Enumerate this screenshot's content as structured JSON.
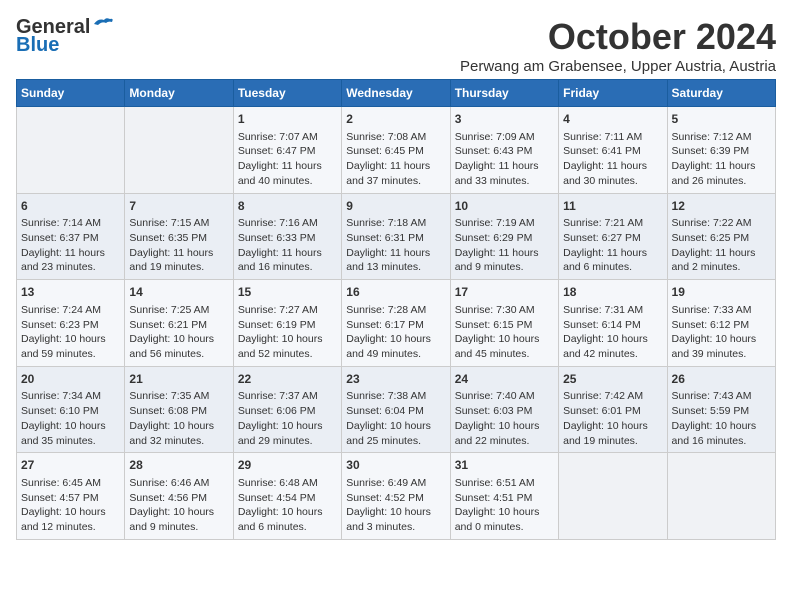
{
  "logo": {
    "general": "General",
    "blue": "Blue"
  },
  "title": "October 2024",
  "location": "Perwang am Grabensee, Upper Austria, Austria",
  "headers": [
    "Sunday",
    "Monday",
    "Tuesday",
    "Wednesday",
    "Thursday",
    "Friday",
    "Saturday"
  ],
  "weeks": [
    [
      {
        "day": "",
        "sunrise": "",
        "sunset": "",
        "daylight": ""
      },
      {
        "day": "",
        "sunrise": "",
        "sunset": "",
        "daylight": ""
      },
      {
        "day": "1",
        "sunrise": "Sunrise: 7:07 AM",
        "sunset": "Sunset: 6:47 PM",
        "daylight": "Daylight: 11 hours and 40 minutes."
      },
      {
        "day": "2",
        "sunrise": "Sunrise: 7:08 AM",
        "sunset": "Sunset: 6:45 PM",
        "daylight": "Daylight: 11 hours and 37 minutes."
      },
      {
        "day": "3",
        "sunrise": "Sunrise: 7:09 AM",
        "sunset": "Sunset: 6:43 PM",
        "daylight": "Daylight: 11 hours and 33 minutes."
      },
      {
        "day": "4",
        "sunrise": "Sunrise: 7:11 AM",
        "sunset": "Sunset: 6:41 PM",
        "daylight": "Daylight: 11 hours and 30 minutes."
      },
      {
        "day": "5",
        "sunrise": "Sunrise: 7:12 AM",
        "sunset": "Sunset: 6:39 PM",
        "daylight": "Daylight: 11 hours and 26 minutes."
      }
    ],
    [
      {
        "day": "6",
        "sunrise": "Sunrise: 7:14 AM",
        "sunset": "Sunset: 6:37 PM",
        "daylight": "Daylight: 11 hours and 23 minutes."
      },
      {
        "day": "7",
        "sunrise": "Sunrise: 7:15 AM",
        "sunset": "Sunset: 6:35 PM",
        "daylight": "Daylight: 11 hours and 19 minutes."
      },
      {
        "day": "8",
        "sunrise": "Sunrise: 7:16 AM",
        "sunset": "Sunset: 6:33 PM",
        "daylight": "Daylight: 11 hours and 16 minutes."
      },
      {
        "day": "9",
        "sunrise": "Sunrise: 7:18 AM",
        "sunset": "Sunset: 6:31 PM",
        "daylight": "Daylight: 11 hours and 13 minutes."
      },
      {
        "day": "10",
        "sunrise": "Sunrise: 7:19 AM",
        "sunset": "Sunset: 6:29 PM",
        "daylight": "Daylight: 11 hours and 9 minutes."
      },
      {
        "day": "11",
        "sunrise": "Sunrise: 7:21 AM",
        "sunset": "Sunset: 6:27 PM",
        "daylight": "Daylight: 11 hours and 6 minutes."
      },
      {
        "day": "12",
        "sunrise": "Sunrise: 7:22 AM",
        "sunset": "Sunset: 6:25 PM",
        "daylight": "Daylight: 11 hours and 2 minutes."
      }
    ],
    [
      {
        "day": "13",
        "sunrise": "Sunrise: 7:24 AM",
        "sunset": "Sunset: 6:23 PM",
        "daylight": "Daylight: 10 hours and 59 minutes."
      },
      {
        "day": "14",
        "sunrise": "Sunrise: 7:25 AM",
        "sunset": "Sunset: 6:21 PM",
        "daylight": "Daylight: 10 hours and 56 minutes."
      },
      {
        "day": "15",
        "sunrise": "Sunrise: 7:27 AM",
        "sunset": "Sunset: 6:19 PM",
        "daylight": "Daylight: 10 hours and 52 minutes."
      },
      {
        "day": "16",
        "sunrise": "Sunrise: 7:28 AM",
        "sunset": "Sunset: 6:17 PM",
        "daylight": "Daylight: 10 hours and 49 minutes."
      },
      {
        "day": "17",
        "sunrise": "Sunrise: 7:30 AM",
        "sunset": "Sunset: 6:15 PM",
        "daylight": "Daylight: 10 hours and 45 minutes."
      },
      {
        "day": "18",
        "sunrise": "Sunrise: 7:31 AM",
        "sunset": "Sunset: 6:14 PM",
        "daylight": "Daylight: 10 hours and 42 minutes."
      },
      {
        "day": "19",
        "sunrise": "Sunrise: 7:33 AM",
        "sunset": "Sunset: 6:12 PM",
        "daylight": "Daylight: 10 hours and 39 minutes."
      }
    ],
    [
      {
        "day": "20",
        "sunrise": "Sunrise: 7:34 AM",
        "sunset": "Sunset: 6:10 PM",
        "daylight": "Daylight: 10 hours and 35 minutes."
      },
      {
        "day": "21",
        "sunrise": "Sunrise: 7:35 AM",
        "sunset": "Sunset: 6:08 PM",
        "daylight": "Daylight: 10 hours and 32 minutes."
      },
      {
        "day": "22",
        "sunrise": "Sunrise: 7:37 AM",
        "sunset": "Sunset: 6:06 PM",
        "daylight": "Daylight: 10 hours and 29 minutes."
      },
      {
        "day": "23",
        "sunrise": "Sunrise: 7:38 AM",
        "sunset": "Sunset: 6:04 PM",
        "daylight": "Daylight: 10 hours and 25 minutes."
      },
      {
        "day": "24",
        "sunrise": "Sunrise: 7:40 AM",
        "sunset": "Sunset: 6:03 PM",
        "daylight": "Daylight: 10 hours and 22 minutes."
      },
      {
        "day": "25",
        "sunrise": "Sunrise: 7:42 AM",
        "sunset": "Sunset: 6:01 PM",
        "daylight": "Daylight: 10 hours and 19 minutes."
      },
      {
        "day": "26",
        "sunrise": "Sunrise: 7:43 AM",
        "sunset": "Sunset: 5:59 PM",
        "daylight": "Daylight: 10 hours and 16 minutes."
      }
    ],
    [
      {
        "day": "27",
        "sunrise": "Sunrise: 6:45 AM",
        "sunset": "Sunset: 4:57 PM",
        "daylight": "Daylight: 10 hours and 12 minutes."
      },
      {
        "day": "28",
        "sunrise": "Sunrise: 6:46 AM",
        "sunset": "Sunset: 4:56 PM",
        "daylight": "Daylight: 10 hours and 9 minutes."
      },
      {
        "day": "29",
        "sunrise": "Sunrise: 6:48 AM",
        "sunset": "Sunset: 4:54 PM",
        "daylight": "Daylight: 10 hours and 6 minutes."
      },
      {
        "day": "30",
        "sunrise": "Sunrise: 6:49 AM",
        "sunset": "Sunset: 4:52 PM",
        "daylight": "Daylight: 10 hours and 3 minutes."
      },
      {
        "day": "31",
        "sunrise": "Sunrise: 6:51 AM",
        "sunset": "Sunset: 4:51 PM",
        "daylight": "Daylight: 10 hours and 0 minutes."
      },
      {
        "day": "",
        "sunrise": "",
        "sunset": "",
        "daylight": ""
      },
      {
        "day": "",
        "sunrise": "",
        "sunset": "",
        "daylight": ""
      }
    ]
  ]
}
